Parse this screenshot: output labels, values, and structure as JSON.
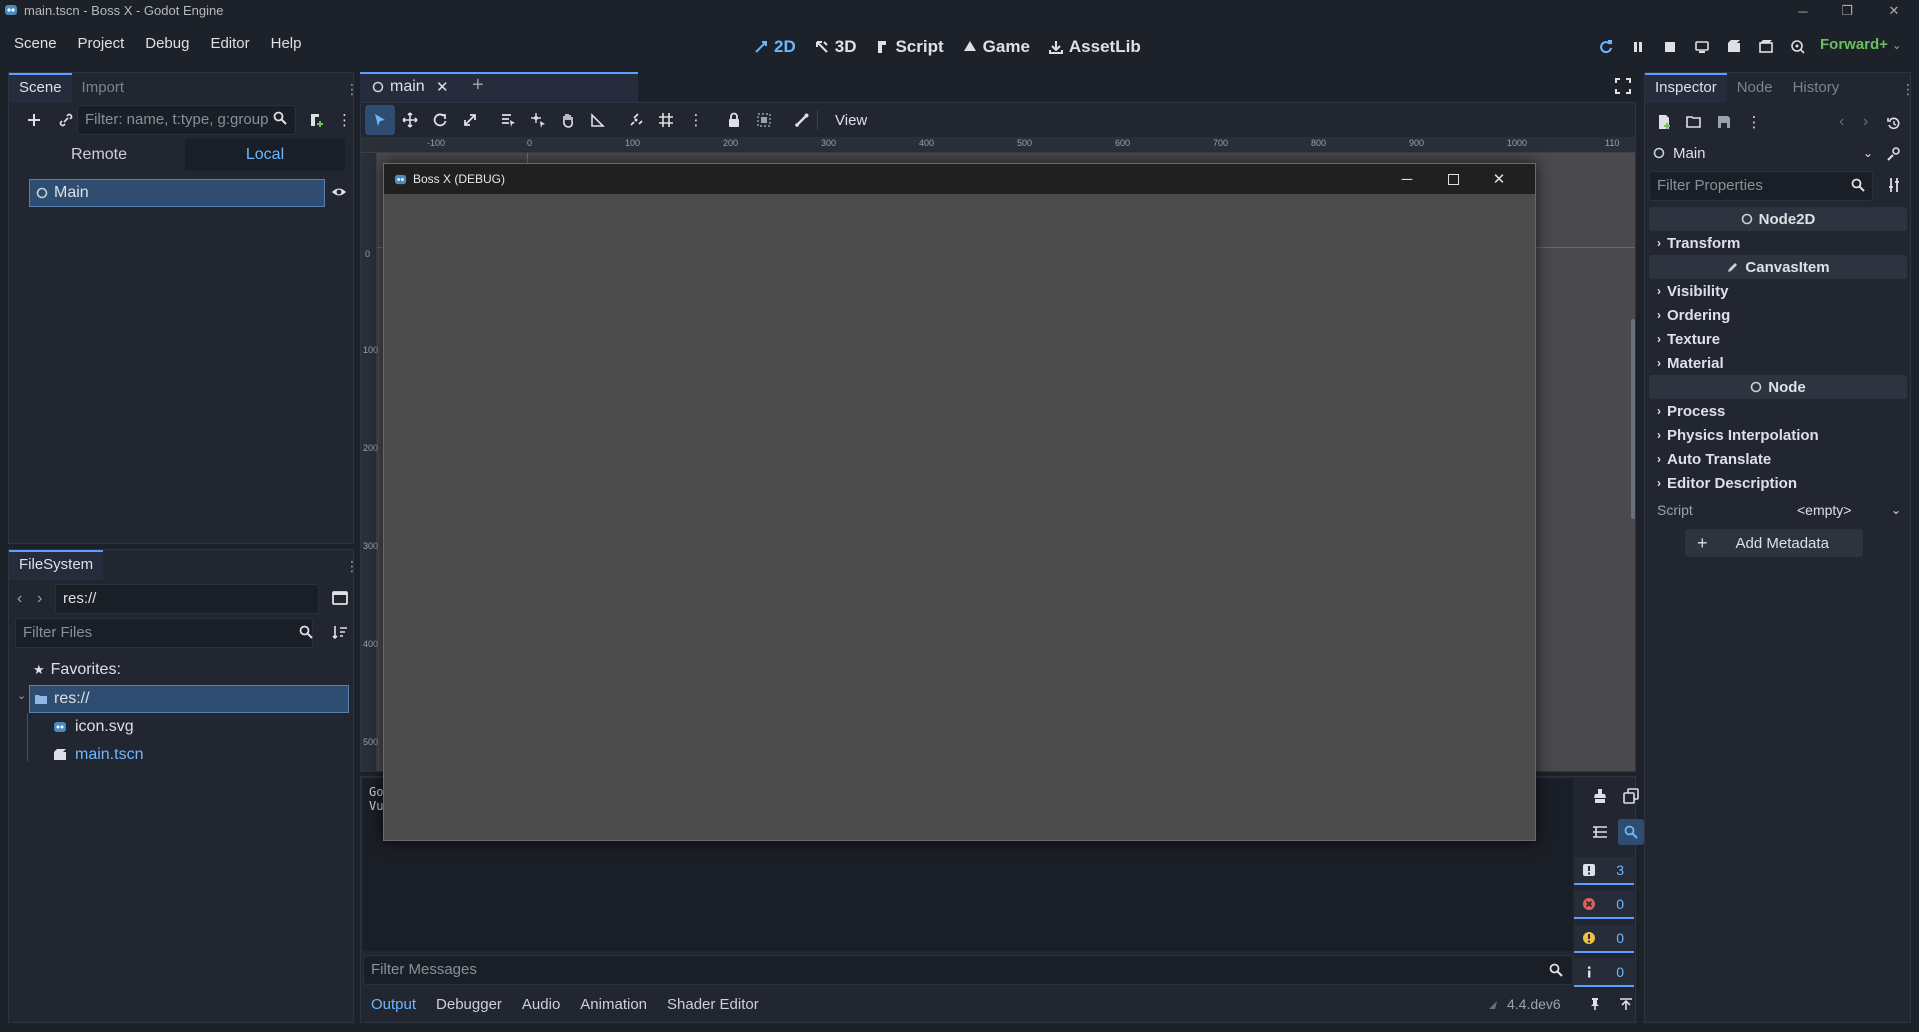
{
  "window": {
    "title": "main.tscn - Boss X - Godot Engine",
    "controls": {
      "minimize": "─",
      "maximize": "❐",
      "close": "✕"
    }
  },
  "menu": [
    "Scene",
    "Project",
    "Debug",
    "Editor",
    "Help"
  ],
  "workspaces": [
    {
      "label": "2D",
      "icon": "2d-icon",
      "active": true
    },
    {
      "label": "3D",
      "icon": "3d-icon",
      "active": false
    },
    {
      "label": "Script",
      "icon": "script-icon",
      "active": false
    },
    {
      "label": "Game",
      "icon": "game-icon",
      "active": false
    },
    {
      "label": "AssetLib",
      "icon": "assetlib-icon",
      "active": false
    }
  ],
  "renderer": "Forward+",
  "scene_dock": {
    "tabs": [
      "Scene",
      "Import"
    ],
    "filter_placeholder": "Filter: name, t:type, g:group",
    "remote_label": "Remote",
    "local_label": "Local",
    "root_node": "Main"
  },
  "filesystem": {
    "tab": "FileSystem",
    "path": "res://",
    "filter_placeholder": "Filter Files",
    "favorites": "Favorites:",
    "root": "res://",
    "files": [
      {
        "name": "icon.svg",
        "icon": "svg-file-icon"
      },
      {
        "name": "main.tscn",
        "icon": "scene-file-icon"
      }
    ]
  },
  "editor_tab": {
    "label": "main"
  },
  "viewport": {
    "view_label": "View",
    "ruler_top": [
      "-100",
      "0",
      "100",
      "200",
      "300",
      "400",
      "500",
      "600",
      "700",
      "800",
      "900",
      "1000",
      "110"
    ],
    "ruler_left": [
      "0",
      "100",
      "200",
      "300",
      "400",
      "500"
    ]
  },
  "game_window": {
    "title": "Boss X (DEBUG)"
  },
  "output": {
    "lines": [
      "Go",
      "Vu"
    ],
    "filter_placeholder": "Filter Messages",
    "counters": [
      {
        "icon": "message-icon",
        "value": "3",
        "color": "#dde0e4"
      },
      {
        "icon": "error-icon",
        "value": "0",
        "color": "#e0605a"
      },
      {
        "icon": "warning-icon",
        "value": "0",
        "color": "#f0c040"
      },
      {
        "icon": "info-icon",
        "value": "0",
        "color": "#dde0e4"
      }
    ]
  },
  "bottom_tabs": [
    "Output",
    "Debugger",
    "Audio",
    "Animation",
    "Shader Editor"
  ],
  "version": "4.4.dev6",
  "inspector": {
    "tabs": [
      "Inspector",
      "Node",
      "History"
    ],
    "object": "Main",
    "filter_placeholder": "Filter Properties",
    "sections": [
      {
        "type": "header",
        "label": "Node2D",
        "icon": "node2d-icon"
      },
      {
        "type": "group",
        "label": "Transform"
      },
      {
        "type": "header",
        "label": "CanvasItem",
        "icon": "canvasitem-icon"
      },
      {
        "type": "group",
        "label": "Visibility"
      },
      {
        "type": "group",
        "label": "Ordering"
      },
      {
        "type": "group",
        "label": "Texture"
      },
      {
        "type": "group",
        "label": "Material"
      },
      {
        "type": "header",
        "label": "Node",
        "icon": "node-icon"
      },
      {
        "type": "group",
        "label": "Process"
      },
      {
        "type": "group",
        "label": "Physics Interpolation"
      },
      {
        "type": "group",
        "label": "Auto Translate"
      },
      {
        "type": "group",
        "label": "Editor Description"
      }
    ],
    "script_label": "Script",
    "script_value": "<empty>",
    "add_metadata": "Add Metadata"
  }
}
